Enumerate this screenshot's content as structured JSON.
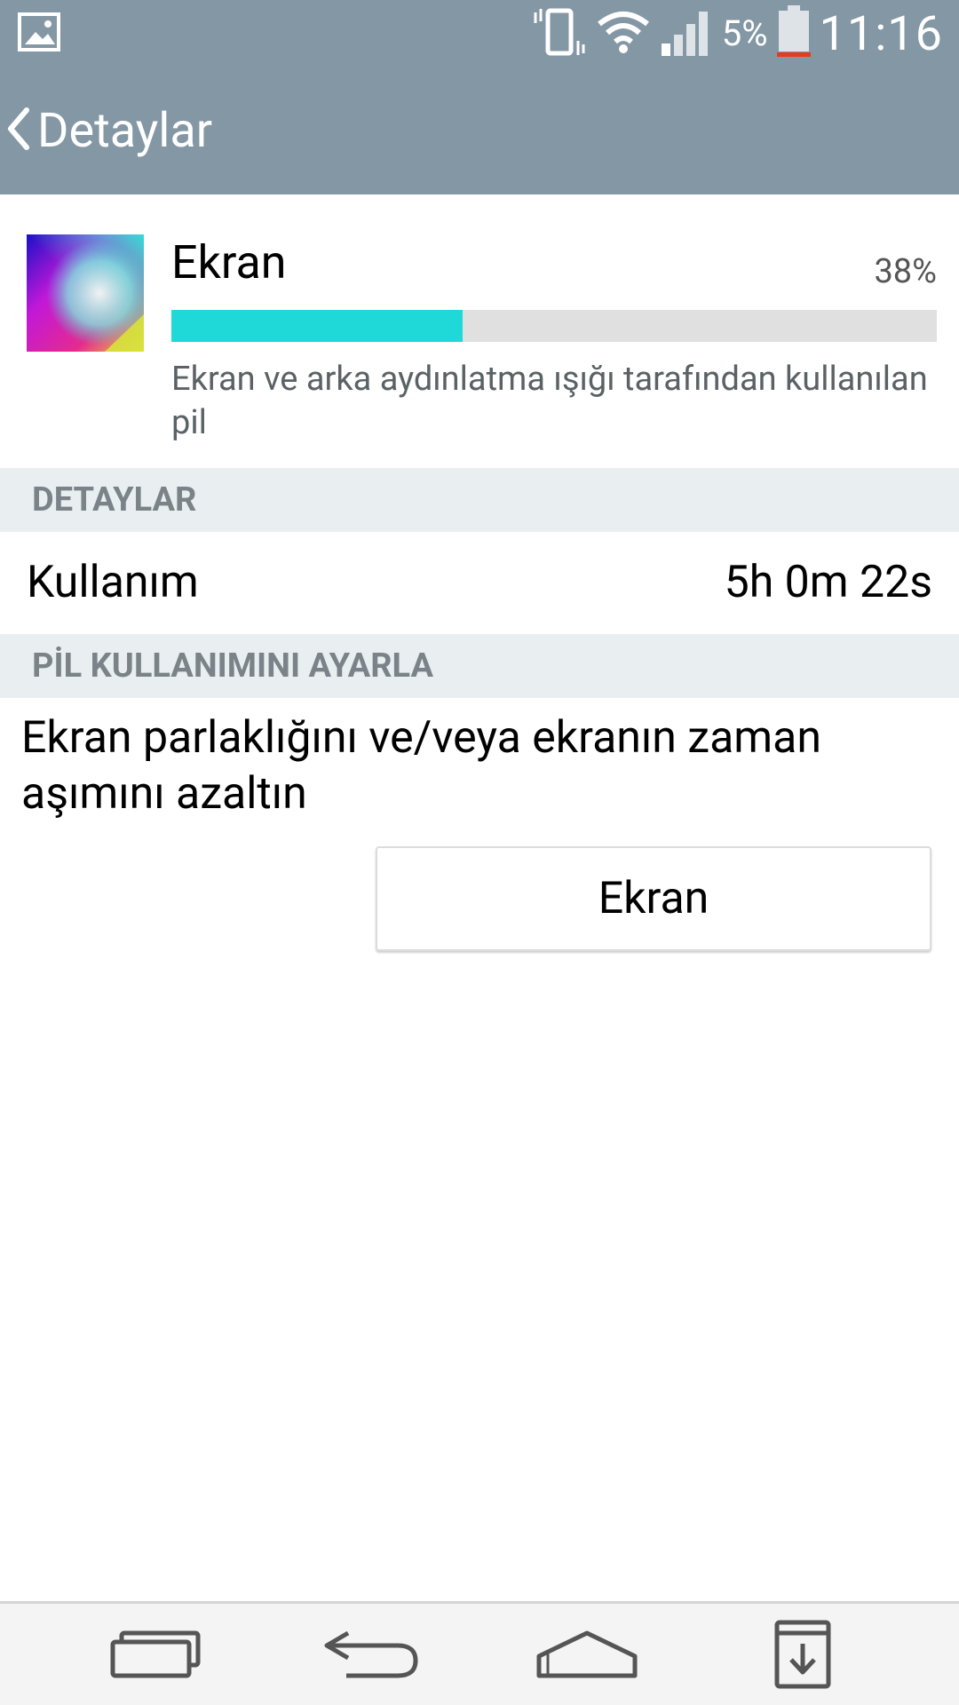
{
  "status_bar": {
    "left_icon": "image-notification-icon",
    "icons": [
      "vibrate-icon",
      "wifi-icon",
      "signal-icon"
    ],
    "battery_percent": "5%",
    "battery_icon": "battery-low-icon",
    "time": "11:16"
  },
  "action_bar": {
    "back_icon": "chevron-left-icon",
    "title": "Detaylar"
  },
  "app": {
    "icon": "display-gradient-icon",
    "name": "Ekran",
    "percent": "38%",
    "usage_fraction": 0.38,
    "description": "Ekran ve arka aydınlatma ışığı tarafından kullanılan pil"
  },
  "details_section": {
    "header": "DETAYLAR",
    "rows": [
      {
        "label": "Kullanım",
        "value": "5h 0m 22s"
      }
    ]
  },
  "adjust_section": {
    "header": "PİL KULLANIMINI AYARLA",
    "tip": "Ekran parlaklığını ve/veya ekranın zaman aşımını azaltın",
    "button_label": "Ekran"
  },
  "nav_bar": {
    "items": [
      "recent-apps-icon",
      "back-icon",
      "home-icon",
      "notification-pull-icon"
    ]
  },
  "colors": {
    "accent_bar": "#8497a5",
    "progress_fill": "#1fd9d9",
    "section_bg": "#e9eff1"
  }
}
